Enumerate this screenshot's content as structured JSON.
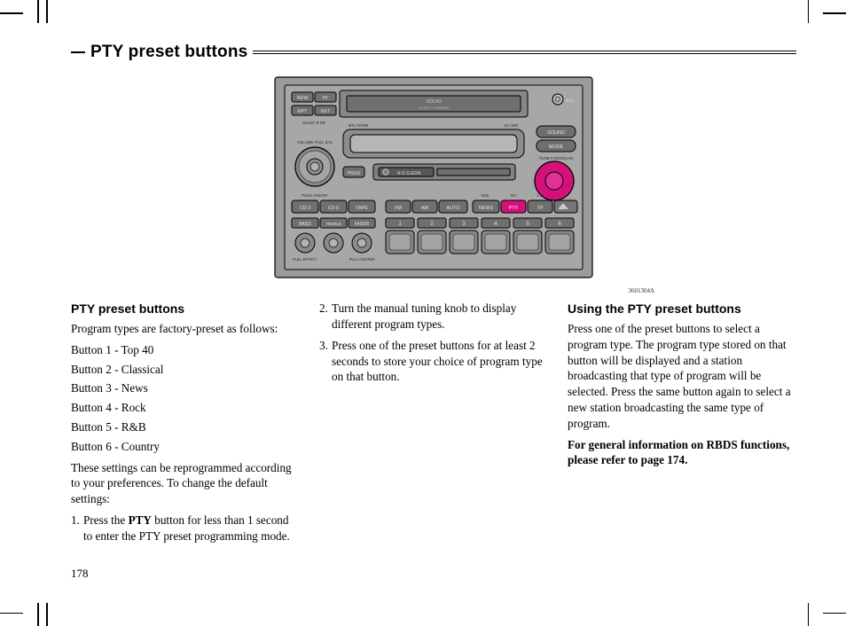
{
  "doc": {
    "title": "PTY preset buttons",
    "page_number": "178",
    "figure_caption": "3601304A"
  },
  "radio": {
    "brand": "VOLVO",
    "subbrand": "6-DISC CHANGER",
    "model": "SC-900",
    "labels": {
      "rew": "REW",
      "ff": "FF",
      "rpt": "RPT",
      "nxt": "NXT",
      "dolby": "DOLBY B NR",
      "mtl_norm": "MTL NORM",
      "volume_pull_bal": "VOLUME PULL BAL",
      "prog": "PROG",
      "rds": "R·D·S EON",
      "sound": "SOUND",
      "mode": "MODE",
      "tune": "TUNE PUSH/SCAN",
      "push_onoff": "PUSH  ON/OFF",
      "cd3": "CD-3",
      "cd6": "CD-6",
      "tape": "TAPE",
      "fm": "FM",
      "am": "AM",
      "auto": "AUTO",
      "rnd": "RND",
      "int": "INT",
      "thr": "1 hr",
      "news": "NEWS",
      "pty": "PTY",
      "tp": "TP",
      "bass": "BASS",
      "treble": "TREBLE",
      "fader": "FADER",
      "pull_effect": "PULL  EFFECT",
      "pull_center": "PULL  CENTER",
      "presets": [
        "1",
        "2",
        "3",
        "4",
        "5",
        "6"
      ]
    }
  },
  "col1": {
    "h": "PTY preset buttons",
    "intro": "Program types are factory-preset as follows:",
    "presets": [
      "Button 1 - Top 40",
      "Button 2 - Classical",
      "Button 3 - News",
      "Button 4 - Rock",
      "Button 5 - R&B",
      "Button 6 - Country"
    ],
    "para2": "These settings can be reprogrammed according to your preferences. To change the default settings:",
    "step1_a": "Press the ",
    "step1_bold": "PTY",
    "step1_b": " button for less than 1 second to enter the PTY preset programming mode."
  },
  "col2": {
    "step2": "Turn the manual tuning knob to display different program types.",
    "step3": "Press one of the preset buttons for at least 2 seconds to store your choice of program type on that button."
  },
  "col3": {
    "h": "Using the PTY preset buttons",
    "para": "Press one of the preset buttons to select a program type. The program type stored on that button will be displayed and a station broadcasting that type of program will be selected. Press the same button again to select a new station broadcasting the same type of program.",
    "bold": "For general information on RBDS functions, please refer to page 174."
  }
}
